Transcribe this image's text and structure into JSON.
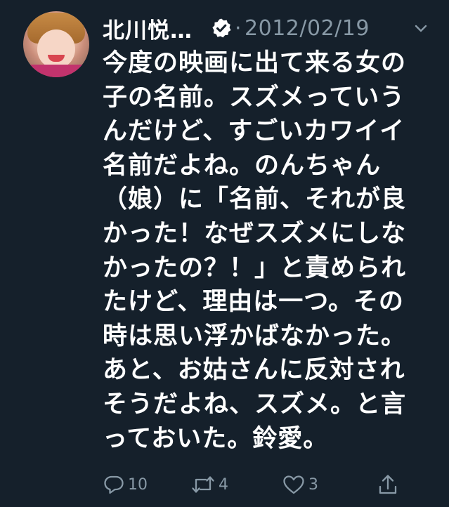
{
  "author": {
    "name": "北川悦…",
    "verified": true,
    "separator": "·",
    "date": "2012/02/19"
  },
  "tweet": {
    "lines": [
      "今度の映画に出て来る女の",
      "子の名前。スズメっていう",
      "んだけど、すごいカワイイ",
      "名前だよね。のんちゃん",
      "（娘）に「名前、それが良",
      "かった！なぜスズメにしな",
      "かったの？！」と責められ",
      "たけど、理由は一つ。その",
      "時は思い浮かばなかった。",
      "あと、お姑さんに反対され",
      "そうだよね、スズメ。と言",
      "っておいた。鈴愛。"
    ]
  },
  "actions": {
    "reply": {
      "icon": "reply-icon",
      "count": "10"
    },
    "retweet": {
      "icon": "retweet-icon",
      "count": "4"
    },
    "like": {
      "icon": "heart-icon",
      "count": "3"
    },
    "share": {
      "icon": "share-icon"
    }
  },
  "colors": {
    "background": "#15202b",
    "text": "#ffffff",
    "secondary": "#8899a6"
  }
}
